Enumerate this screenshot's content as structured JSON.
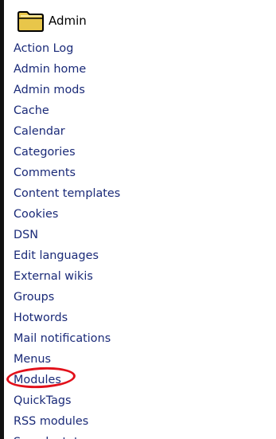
{
  "section": {
    "title": "Admin",
    "icon": "folder-icon"
  },
  "menu": {
    "items": [
      {
        "label": "Action Log"
      },
      {
        "label": "Admin home"
      },
      {
        "label": "Admin mods"
      },
      {
        "label": "Cache"
      },
      {
        "label": "Calendar"
      },
      {
        "label": "Categories"
      },
      {
        "label": "Comments"
      },
      {
        "label": "Content templates"
      },
      {
        "label": "Cookies"
      },
      {
        "label": "DSN"
      },
      {
        "label": "Edit languages"
      },
      {
        "label": "External wikis"
      },
      {
        "label": "Groups"
      },
      {
        "label": "Hotwords"
      },
      {
        "label": "Mail notifications"
      },
      {
        "label": "Menus"
      },
      {
        "label": "Modules",
        "highlighted": true
      },
      {
        "label": "QuickTags"
      },
      {
        "label": "RSS modules"
      },
      {
        "label": "Search stats"
      }
    ]
  },
  "colors": {
    "link": "#1a2a78",
    "highlight_ring": "#e2101a",
    "folder": "#e8c64a"
  }
}
